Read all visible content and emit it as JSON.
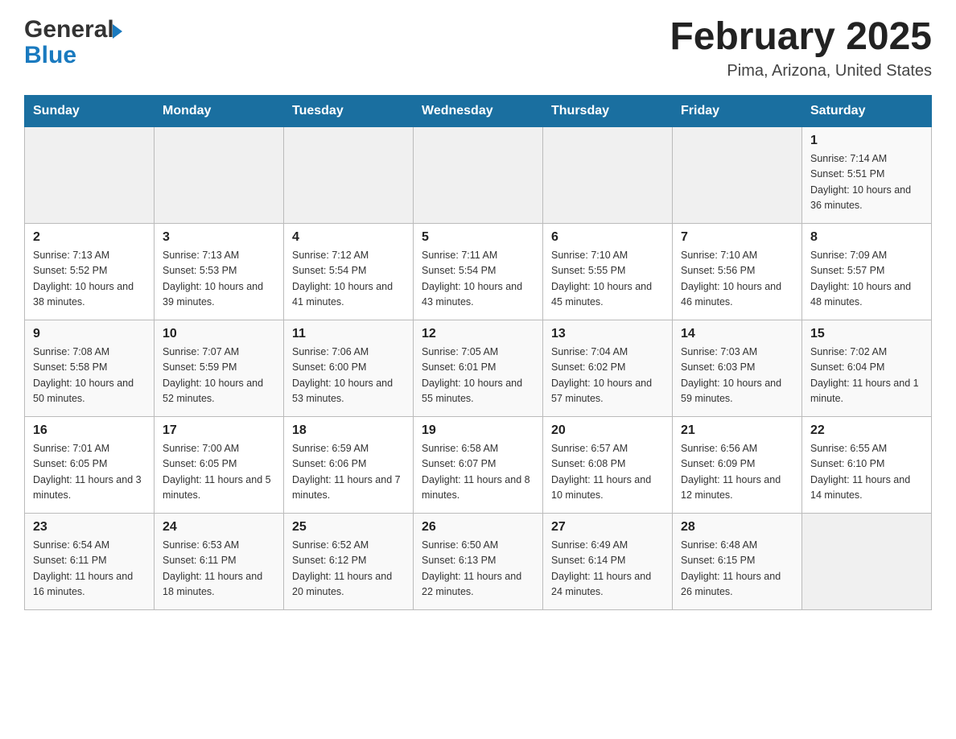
{
  "header": {
    "logo_general": "General",
    "logo_blue": "Blue",
    "month_title": "February 2025",
    "location": "Pima, Arizona, United States"
  },
  "calendar": {
    "weekdays": [
      "Sunday",
      "Monday",
      "Tuesday",
      "Wednesday",
      "Thursday",
      "Friday",
      "Saturday"
    ],
    "weeks": [
      [
        {
          "day": "",
          "sunrise": "",
          "sunset": "",
          "daylight": "",
          "empty": true
        },
        {
          "day": "",
          "sunrise": "",
          "sunset": "",
          "daylight": "",
          "empty": true
        },
        {
          "day": "",
          "sunrise": "",
          "sunset": "",
          "daylight": "",
          "empty": true
        },
        {
          "day": "",
          "sunrise": "",
          "sunset": "",
          "daylight": "",
          "empty": true
        },
        {
          "day": "",
          "sunrise": "",
          "sunset": "",
          "daylight": "",
          "empty": true
        },
        {
          "day": "",
          "sunrise": "",
          "sunset": "",
          "daylight": "",
          "empty": true
        },
        {
          "day": "1",
          "sunrise": "Sunrise: 7:14 AM",
          "sunset": "Sunset: 5:51 PM",
          "daylight": "Daylight: 10 hours and 36 minutes.",
          "empty": false
        }
      ],
      [
        {
          "day": "2",
          "sunrise": "Sunrise: 7:13 AM",
          "sunset": "Sunset: 5:52 PM",
          "daylight": "Daylight: 10 hours and 38 minutes.",
          "empty": false
        },
        {
          "day": "3",
          "sunrise": "Sunrise: 7:13 AM",
          "sunset": "Sunset: 5:53 PM",
          "daylight": "Daylight: 10 hours and 39 minutes.",
          "empty": false
        },
        {
          "day": "4",
          "sunrise": "Sunrise: 7:12 AM",
          "sunset": "Sunset: 5:54 PM",
          "daylight": "Daylight: 10 hours and 41 minutes.",
          "empty": false
        },
        {
          "day": "5",
          "sunrise": "Sunrise: 7:11 AM",
          "sunset": "Sunset: 5:54 PM",
          "daylight": "Daylight: 10 hours and 43 minutes.",
          "empty": false
        },
        {
          "day": "6",
          "sunrise": "Sunrise: 7:10 AM",
          "sunset": "Sunset: 5:55 PM",
          "daylight": "Daylight: 10 hours and 45 minutes.",
          "empty": false
        },
        {
          "day": "7",
          "sunrise": "Sunrise: 7:10 AM",
          "sunset": "Sunset: 5:56 PM",
          "daylight": "Daylight: 10 hours and 46 minutes.",
          "empty": false
        },
        {
          "day": "8",
          "sunrise": "Sunrise: 7:09 AM",
          "sunset": "Sunset: 5:57 PM",
          "daylight": "Daylight: 10 hours and 48 minutes.",
          "empty": false
        }
      ],
      [
        {
          "day": "9",
          "sunrise": "Sunrise: 7:08 AM",
          "sunset": "Sunset: 5:58 PM",
          "daylight": "Daylight: 10 hours and 50 minutes.",
          "empty": false
        },
        {
          "day": "10",
          "sunrise": "Sunrise: 7:07 AM",
          "sunset": "Sunset: 5:59 PM",
          "daylight": "Daylight: 10 hours and 52 minutes.",
          "empty": false
        },
        {
          "day": "11",
          "sunrise": "Sunrise: 7:06 AM",
          "sunset": "Sunset: 6:00 PM",
          "daylight": "Daylight: 10 hours and 53 minutes.",
          "empty": false
        },
        {
          "day": "12",
          "sunrise": "Sunrise: 7:05 AM",
          "sunset": "Sunset: 6:01 PM",
          "daylight": "Daylight: 10 hours and 55 minutes.",
          "empty": false
        },
        {
          "day": "13",
          "sunrise": "Sunrise: 7:04 AM",
          "sunset": "Sunset: 6:02 PM",
          "daylight": "Daylight: 10 hours and 57 minutes.",
          "empty": false
        },
        {
          "day": "14",
          "sunrise": "Sunrise: 7:03 AM",
          "sunset": "Sunset: 6:03 PM",
          "daylight": "Daylight: 10 hours and 59 minutes.",
          "empty": false
        },
        {
          "day": "15",
          "sunrise": "Sunrise: 7:02 AM",
          "sunset": "Sunset: 6:04 PM",
          "daylight": "Daylight: 11 hours and 1 minute.",
          "empty": false
        }
      ],
      [
        {
          "day": "16",
          "sunrise": "Sunrise: 7:01 AM",
          "sunset": "Sunset: 6:05 PM",
          "daylight": "Daylight: 11 hours and 3 minutes.",
          "empty": false
        },
        {
          "day": "17",
          "sunrise": "Sunrise: 7:00 AM",
          "sunset": "Sunset: 6:05 PM",
          "daylight": "Daylight: 11 hours and 5 minutes.",
          "empty": false
        },
        {
          "day": "18",
          "sunrise": "Sunrise: 6:59 AM",
          "sunset": "Sunset: 6:06 PM",
          "daylight": "Daylight: 11 hours and 7 minutes.",
          "empty": false
        },
        {
          "day": "19",
          "sunrise": "Sunrise: 6:58 AM",
          "sunset": "Sunset: 6:07 PM",
          "daylight": "Daylight: 11 hours and 8 minutes.",
          "empty": false
        },
        {
          "day": "20",
          "sunrise": "Sunrise: 6:57 AM",
          "sunset": "Sunset: 6:08 PM",
          "daylight": "Daylight: 11 hours and 10 minutes.",
          "empty": false
        },
        {
          "day": "21",
          "sunrise": "Sunrise: 6:56 AM",
          "sunset": "Sunset: 6:09 PM",
          "daylight": "Daylight: 11 hours and 12 minutes.",
          "empty": false
        },
        {
          "day": "22",
          "sunrise": "Sunrise: 6:55 AM",
          "sunset": "Sunset: 6:10 PM",
          "daylight": "Daylight: 11 hours and 14 minutes.",
          "empty": false
        }
      ],
      [
        {
          "day": "23",
          "sunrise": "Sunrise: 6:54 AM",
          "sunset": "Sunset: 6:11 PM",
          "daylight": "Daylight: 11 hours and 16 minutes.",
          "empty": false
        },
        {
          "day": "24",
          "sunrise": "Sunrise: 6:53 AM",
          "sunset": "Sunset: 6:11 PM",
          "daylight": "Daylight: 11 hours and 18 minutes.",
          "empty": false
        },
        {
          "day": "25",
          "sunrise": "Sunrise: 6:52 AM",
          "sunset": "Sunset: 6:12 PM",
          "daylight": "Daylight: 11 hours and 20 minutes.",
          "empty": false
        },
        {
          "day": "26",
          "sunrise": "Sunrise: 6:50 AM",
          "sunset": "Sunset: 6:13 PM",
          "daylight": "Daylight: 11 hours and 22 minutes.",
          "empty": false
        },
        {
          "day": "27",
          "sunrise": "Sunrise: 6:49 AM",
          "sunset": "Sunset: 6:14 PM",
          "daylight": "Daylight: 11 hours and 24 minutes.",
          "empty": false
        },
        {
          "day": "28",
          "sunrise": "Sunrise: 6:48 AM",
          "sunset": "Sunset: 6:15 PM",
          "daylight": "Daylight: 11 hours and 26 minutes.",
          "empty": false
        },
        {
          "day": "",
          "sunrise": "",
          "sunset": "",
          "daylight": "",
          "empty": true
        }
      ]
    ]
  }
}
